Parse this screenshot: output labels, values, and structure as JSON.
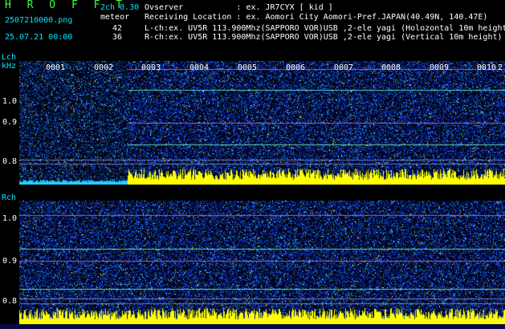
{
  "brand": "H R O F F T",
  "file": {
    "name": "2507210000.png",
    "datetime": "25.07.21 00:00"
  },
  "mode": {
    "ch": "2ch 0.30",
    "type": "meteor",
    "count_l": "42",
    "count_r": "36"
  },
  "info": {
    "observer": "Ovserver           : ex. JR7CYX [ kid ]",
    "location": "Receiving Location : ex. Aomori City Aomori-Pref.JAPAN(40.49N, 140.47E)",
    "lch": "L-ch:ex. UV5R 113.900Mhz(SAPPORO VOR)USB ,2-ele yagi (Holozontal 10m height)",
    "rch": "R-ch:ex. UV5R 113.900Mhz(SAPPORO VOR)USB ,2-ele yagi (Vertical 10m height)"
  },
  "lch": {
    "label": "Lch",
    "unit": "kHz",
    "ticks": [
      "1.0",
      "0.9",
      "0.8"
    ]
  },
  "rch": {
    "label": "Rch",
    "ticks": [
      "1.0",
      "0.9",
      "0.8"
    ]
  },
  "segments": [
    "0001",
    "0002",
    "0003",
    "0004",
    "0005",
    "0006",
    "0007",
    "0008",
    "0009",
    "0010",
    "2"
  ],
  "colors": {
    "bg": "#000000",
    "noise": "#0a1880",
    "signal": "#ffff00",
    "cyan": "#00e8ff"
  }
}
